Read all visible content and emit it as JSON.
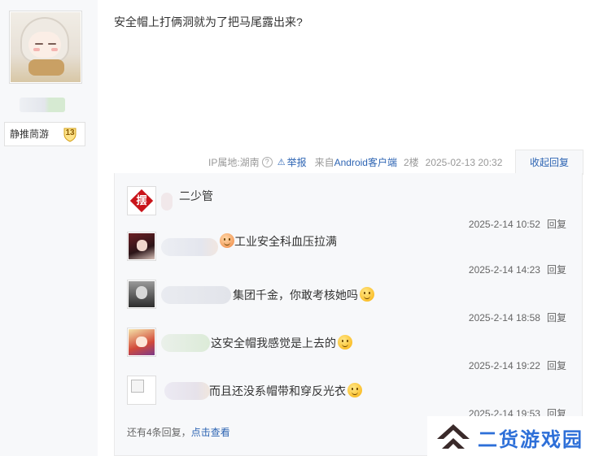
{
  "author": {
    "badge_name": "静推茼游",
    "badge_level": "13"
  },
  "post": {
    "text": "安全帽上打俩洞就为了把马尾露出来?"
  },
  "tail": {
    "ip": "IP属地:湖南",
    "report": "举报",
    "from_prefix": "来自",
    "client": "Android客户端",
    "floor": "2楼",
    "time": "2025-02-13 20:32",
    "collapse": "收起回复"
  },
  "replies": [
    {
      "user": "二少管",
      "content": "",
      "time": "2025-2-14 10:52",
      "reply": "回复"
    },
    {
      "user": "",
      "content": "工业安全科血压拉满",
      "time": "2025-2-14 14:23",
      "reply": "回复"
    },
    {
      "user": "",
      "content": " 集团千金，你敢考核她吗",
      "time": "2025-2-14 18:58",
      "reply": "回复"
    },
    {
      "user": "",
      "content": "这安全帽我感觉是上去的",
      "time": "2025-2-14 19:22",
      "reply": "回复"
    },
    {
      "user": "",
      "content": "而且还没系帽带和穿反光衣",
      "time": "2025-2-14 19:53",
      "reply": "回复"
    }
  ],
  "more": {
    "prefix": "还有4条回复，",
    "link": "点击查看"
  },
  "watermark": {
    "text": "二货游戏园"
  },
  "icons": {
    "help": "question-circle-icon",
    "warn": "warning-triangle-icon",
    "emoji": "smiley-emoji-icon",
    "logo": "double-chevron-logo-icon"
  },
  "colors": {
    "link": "#2d64b3",
    "reply_bg": "#f7f8fa",
    "watermark": "#2d6fd8"
  }
}
